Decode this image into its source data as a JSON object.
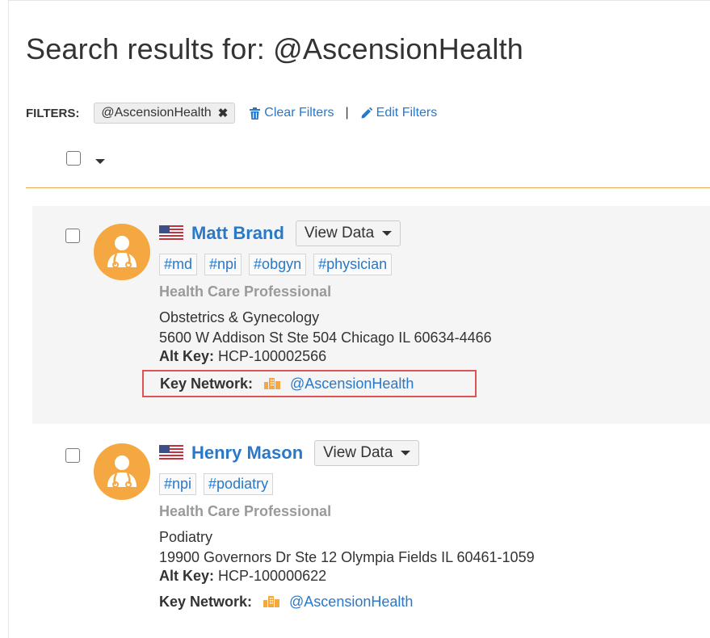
{
  "page": {
    "title": "Search results for: @AscensionHealth"
  },
  "filters": {
    "label": "FILTERS:",
    "chip": "@AscensionHealth",
    "chip_remove": "✖",
    "clear": "Clear Filters",
    "separator": "|",
    "edit": "Edit Filters"
  },
  "colors": {
    "accent": "#2a78c8",
    "avatar": "#f5a742",
    "rule": "#f0a657",
    "highlight_border": "#e05353"
  },
  "results": [
    {
      "name": "Matt Brand",
      "view_data": "View Data",
      "tags": [
        "#md",
        "#npi",
        "#obgyn",
        "#physician"
      ],
      "type": "Health Care Professional",
      "specialty": "Obstetrics & Gynecology",
      "address": "5600 W Addison St Ste 504 Chicago IL 60634-4466",
      "alt_key_label": "Alt Key:",
      "alt_key": "HCP-100002566",
      "network_label": "Key Network:",
      "network": "@AscensionHealth"
    },
    {
      "name": "Henry Mason",
      "view_data": "View Data",
      "tags": [
        "#npi",
        "#podiatry"
      ],
      "type": "Health Care Professional",
      "specialty": "Podiatry",
      "address": "19900 Governors Dr Ste 12 Olympia Fields IL 60461-1059",
      "alt_key_label": "Alt Key:",
      "alt_key": "HCP-100000622",
      "network_label": "Key Network:",
      "network": "@AscensionHealth"
    }
  ],
  "icons": {
    "chip_remove": "close-icon",
    "clear": "trash-icon",
    "edit": "pencil-icon",
    "flag": "us-flag-icon",
    "avatar": "doctor-icon",
    "network": "building-icon"
  }
}
